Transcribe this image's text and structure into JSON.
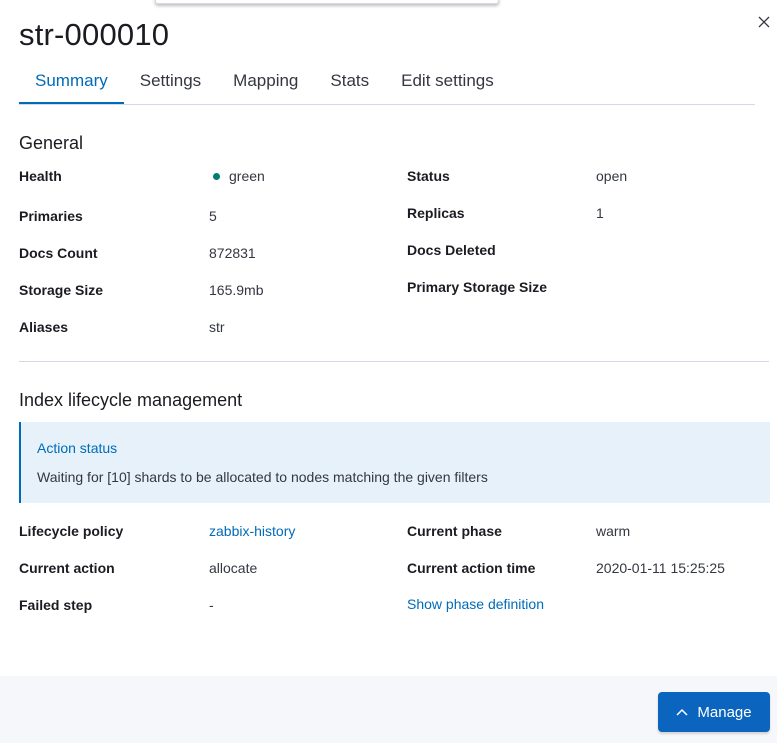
{
  "index": {
    "name": "str-000010"
  },
  "tabs": [
    {
      "label": "Summary",
      "selected": true
    },
    {
      "label": "Settings"
    },
    {
      "label": "Mapping"
    },
    {
      "label": "Stats"
    },
    {
      "label": "Edit settings"
    }
  ],
  "general": {
    "title": "General",
    "fields": {
      "health": {
        "label": "Health",
        "value": "green",
        "color": "#017d73"
      },
      "status": {
        "label": "Status",
        "value": "open"
      },
      "primaries": {
        "label": "Primaries",
        "value": "5"
      },
      "replicas": {
        "label": "Replicas",
        "value": "1"
      },
      "docs_count": {
        "label": "Docs Count",
        "value": "872831"
      },
      "docs_deleted": {
        "label": "Docs Deleted",
        "value": ""
      },
      "storage_size": {
        "label": "Storage Size",
        "value": "165.9mb"
      },
      "primary_storage_size": {
        "label": "Primary Storage Size",
        "value": ""
      },
      "aliases": {
        "label": "Aliases",
        "value": "str"
      }
    }
  },
  "ilm": {
    "title": "Index lifecycle management",
    "callout": {
      "title": "Action status",
      "message": "Waiting for [10] shards to be allocated to nodes matching the given filters"
    },
    "fields": {
      "lifecycle_policy": {
        "label": "Lifecycle policy",
        "value": "zabbix-history"
      },
      "current_phase": {
        "label": "Current phase",
        "value": "warm"
      },
      "current_action": {
        "label": "Current action",
        "value": "allocate"
      },
      "current_action_time": {
        "label": "Current action time",
        "value": "2020-01-11 15:25:25"
      },
      "failed_step": {
        "label": "Failed step",
        "value": "-"
      },
      "show_phase_definition": "Show phase definition"
    }
  },
  "footer": {
    "manage_label": "Manage"
  },
  "colors": {
    "accent": "#006bb8",
    "button": "#0b64bd",
    "health_green": "#017d73"
  }
}
